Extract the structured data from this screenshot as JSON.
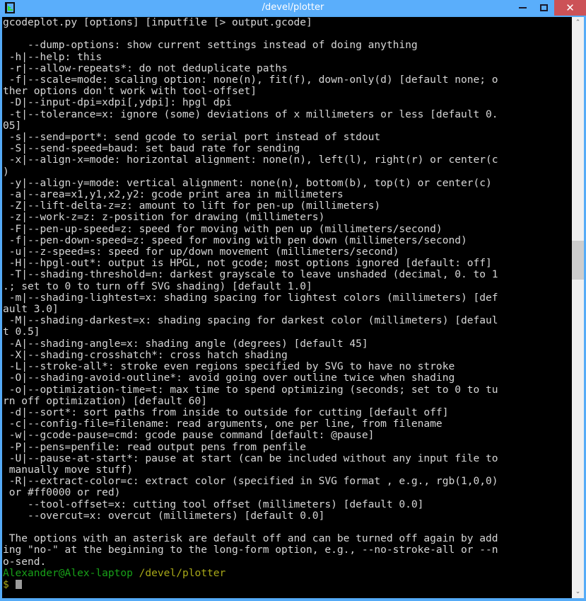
{
  "window": {
    "title": "/devel/plotter",
    "app_icon": "terminal-icon",
    "buttons": {
      "minimize": "minimize-icon",
      "maximize": "maximize-icon",
      "close": "✕"
    }
  },
  "scrollbar": {
    "up_arrow": "⌃",
    "down_arrow": "⌄"
  },
  "terminal": {
    "output": "gcodeplot.py [options] [inputfile [> output.gcode]\n\n    --dump-options: show current settings instead of doing anything\n -h|--help: this\n -r|--allow-repeats*: do not deduplicate paths\n -f|--scale=mode: scaling option: none(n), fit(f), down-only(d) [default none; o\nther options don't work with tool-offset]\n -D|--input-dpi=xdpi[,ydpi]: hpgl dpi\n -t|--tolerance=x: ignore (some) deviations of x millimeters or less [default 0.\n05]\n -s|--send=port*: send gcode to serial port instead of stdout\n -S|--send-speed=baud: set baud rate for sending\n -x|--align-x=mode: horizontal alignment: none(n), left(l), right(r) or center(c\n)\n -y|--align-y=mode: vertical alignment: none(n), bottom(b), top(t) or center(c)\n -a|--area=x1,y1,x2,y2: gcode print area in millimeters\n -Z|--lift-delta-z=z: amount to lift for pen-up (millimeters)\n -z|--work-z=z: z-position for drawing (millimeters)\n -F|--pen-up-speed=z: speed for moving with pen up (millimeters/second)\n -f|--pen-down-speed=z: speed for moving with pen down (millimeters/second)\n -u|--z-speed=s: speed for up/down movement (millimeters/second)\n -H|--hpgl-out*: output is HPGL, not gcode; most options ignored [default: off]\n -T|--shading-threshold=n: darkest grayscale to leave unshaded (decimal, 0. to 1\n.; set to 0 to turn off SVG shading) [default 1.0]\n -m|--shading-lightest=x: shading spacing for lightest colors (millimeters) [def\nault 3.0]\n -M|--shading-darkest=x: shading spacing for darkest color (millimeters) [defaul\nt 0.5]\n -A|--shading-angle=x: shading angle (degrees) [default 45]\n -X|--shading-crosshatch*: cross hatch shading\n -L|--stroke-all*: stroke even regions specified by SVG to have no stroke\n -O|--shading-avoid-outline*: avoid going over outline twice when shading\n -o|--optimization-time=t: max time to spend optimizing (seconds; set to 0 to tu\nrn off optimization) [default 60]\n -d|--sort*: sort paths from inside to outside for cutting [default off]\n -c|--config-file=filename: read arguments, one per line, from filename\n -w|--gcode-pause=cmd: gcode pause command [default: @pause]\n -P|--pens=penfile: read output pens from penfile\n -U|--pause-at-start*: pause at start (can be included without any input file to\n manually move stuff)\n -R|--extract-color=c: extract color (specified in SVG format , e.g., rgb(1,0,0)\n or #ff0000 or red)\n    --tool-offset=x: cutting tool offset (millimeters) [default 0.0]\n    --overcut=x: overcut (millimeters) [default 0.0]\n\n The options with an asterisk are default off and can be turned off again by add\ning \"no-\" at the beginning to the long-form option, e.g., --no-stroke-all or --n\no-send.\n",
    "prompt": {
      "user_host": "Alexander@Alex-laptop",
      "path": "/devel/plotter",
      "symbol": "$",
      "input": ""
    }
  },
  "colors": {
    "titlebar": "#5aaefb",
    "close_button": "#cc5257",
    "terminal_background": "#000000",
    "terminal_foreground": "#d6d6d6",
    "prompt_user": "#18a018",
    "prompt_path": "#a8a818",
    "scrollbar_track": "#f0f0f0"
  }
}
